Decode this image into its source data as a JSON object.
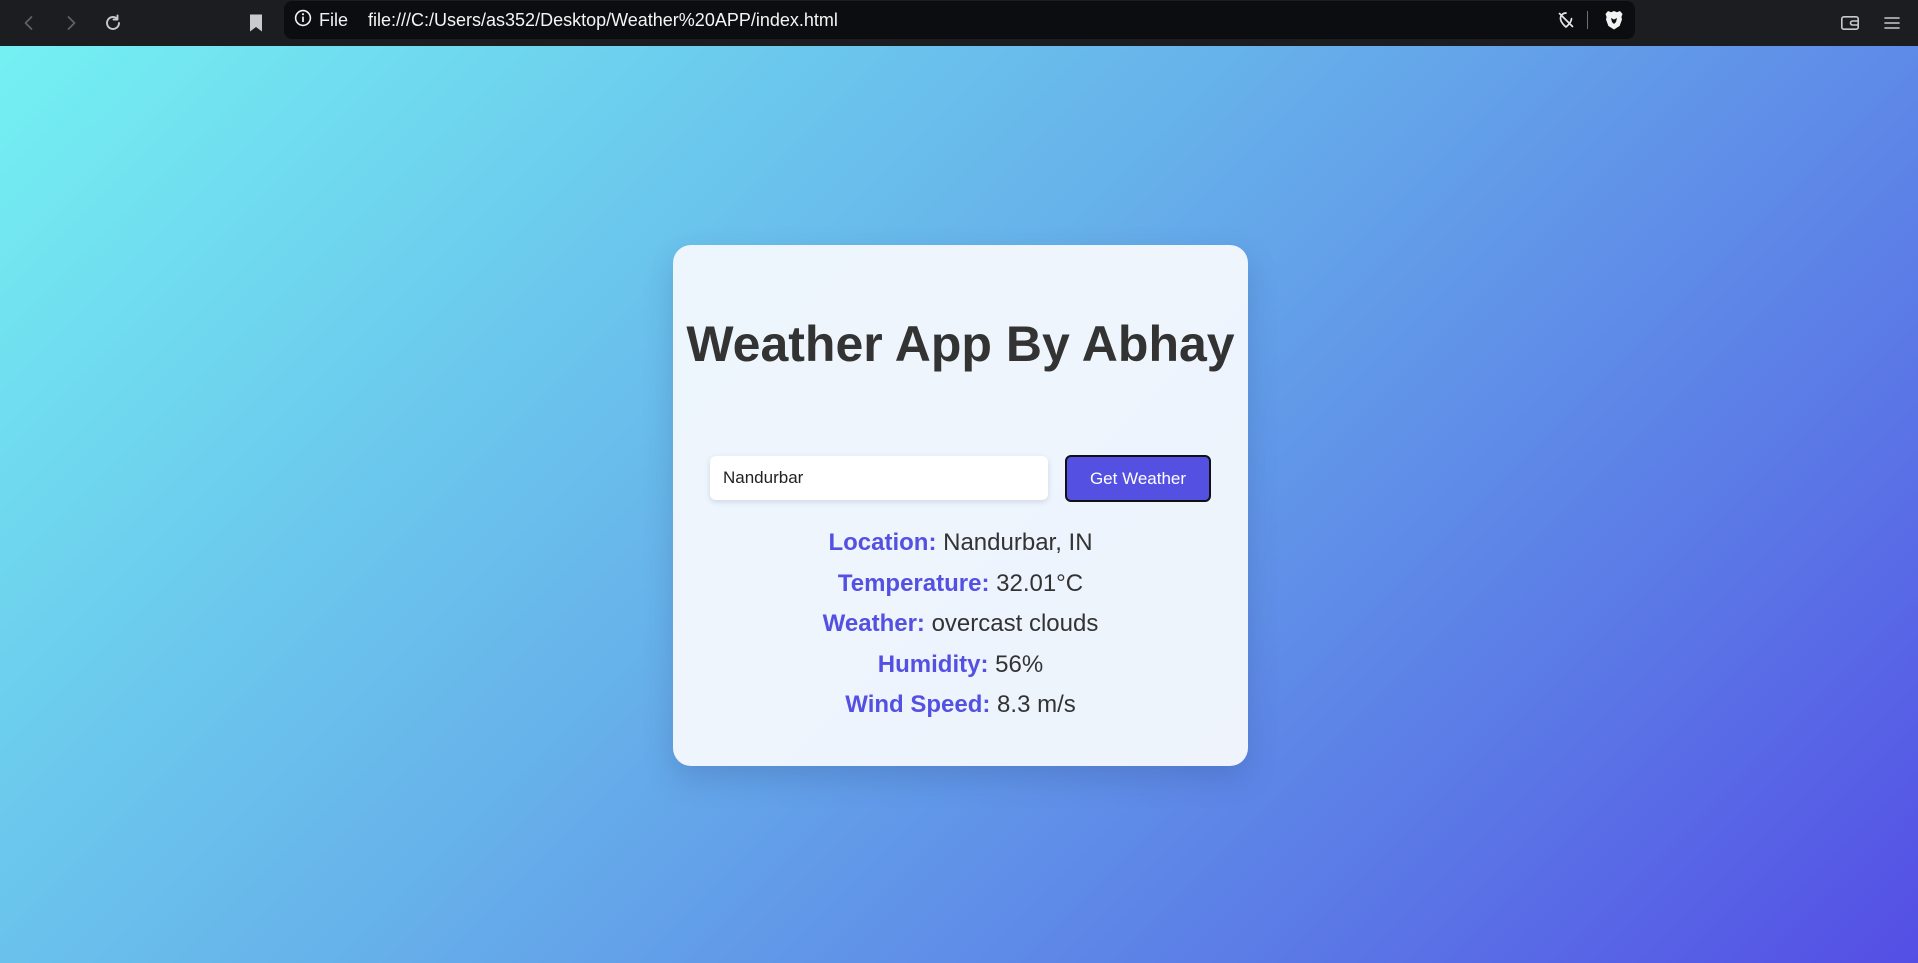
{
  "browser": {
    "site_info_label": "File",
    "url": "file:///C:/Users/as352/Desktop/Weather%20APP/index.html",
    "icons": {
      "back": "back-arrow-icon",
      "forward": "forward-arrow-icon",
      "reload": "reload-icon",
      "bookmark": "bookmark-icon",
      "info": "info-icon",
      "tracking": "tracking-off-icon",
      "brave": "brave-shield-icon",
      "wallet": "wallet-icon",
      "menu": "menu-icon"
    }
  },
  "app": {
    "title": "Weather App By Abhay",
    "input_value": "Nandurbar",
    "button_label": "Get Weather",
    "results": {
      "location_label": "Location:",
      "location_value": "Nandurbar, IN",
      "temperature_label": "Temperature:",
      "temperature_value": "32.01°C",
      "weather_label": "Weather:",
      "weather_value": "overcast clouds",
      "humidity_label": "Humidity:",
      "humidity_value": "56%",
      "wind_label": "Wind Speed:",
      "wind_value": "8.3 m/s"
    }
  },
  "colors": {
    "accent": "#5451e2",
    "title_text": "#333333",
    "gradient_start": "#74f0f2",
    "gradient_end": "#544ee5"
  }
}
